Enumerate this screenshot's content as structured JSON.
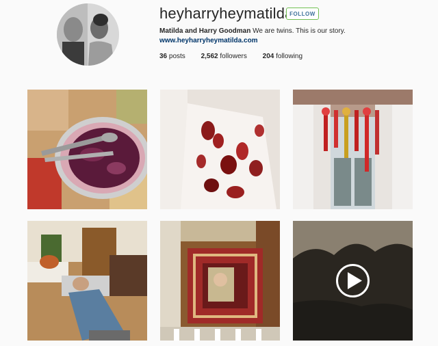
{
  "profile": {
    "username": "heyharryheymatilda",
    "follow_label": "FOLLOW",
    "full_name": "Matilda and Harry Goodman",
    "bio": " We are twins. This is our story.",
    "website": "www.heyharryheymatilda.com"
  },
  "stats": {
    "posts_count": "36",
    "posts_label": " posts",
    "followers_count": "2,562",
    "followers_label": " followers",
    "following_count": "204",
    "following_label": " following"
  },
  "colors": {
    "follow_border": "#70c050",
    "follow_text": "#3f729b",
    "link": "#003569"
  },
  "posts": [
    {
      "subject": "blueberry pie with spoons"
    },
    {
      "subject": "rose petals in glass"
    },
    {
      "subject": "window with ribbons and curtains"
    },
    {
      "subject": "man lying on floor"
    },
    {
      "subject": "room with rug from above"
    },
    {
      "subject": "trees video",
      "icon": "play-icon"
    }
  ]
}
